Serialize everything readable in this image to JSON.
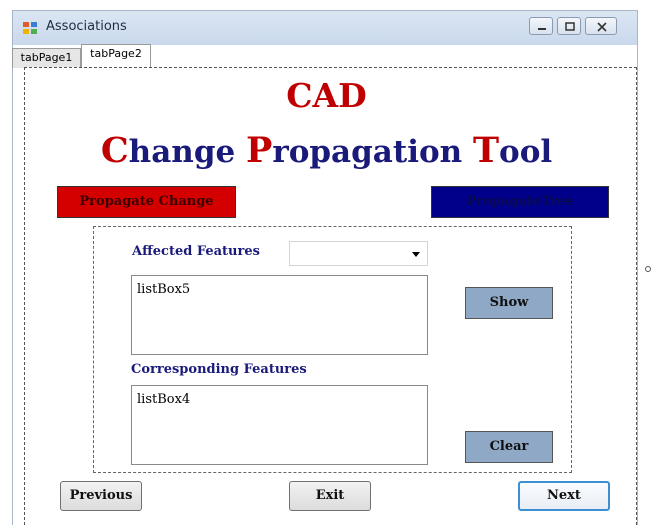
{
  "window": {
    "title": "Associations"
  },
  "tabs": [
    {
      "label": "tabPage1",
      "active": false
    },
    {
      "label": "tabPage2",
      "active": true
    }
  ],
  "header": {
    "title": "CAD",
    "subtitle_parts": [
      {
        "cap": "C",
        "rest": "hange "
      },
      {
        "cap": "P",
        "rest": "ropagation "
      },
      {
        "cap": "T",
        "rest": "ool"
      }
    ]
  },
  "actions": {
    "propagate_change": "Propagate Change",
    "propagate_tree": "PropagateTree"
  },
  "affected": {
    "label": "Affected Features",
    "combo_value": "",
    "listbox_text": "listBox5"
  },
  "corresponding": {
    "label": "Corresponding Features",
    "listbox_text": "listBox4"
  },
  "buttons": {
    "show": "Show",
    "clear": "Clear",
    "previous": "Previous",
    "exit": "Exit",
    "next": "Next"
  },
  "colors": {
    "title_red": "#c00000",
    "title_navy": "#1a1a7a",
    "propagate_change_bg": "#d40000",
    "propagate_tree_bg": "#00008b",
    "side_button_bg": "#8fa8c6",
    "next_focus_border": "#3d8fd1"
  }
}
